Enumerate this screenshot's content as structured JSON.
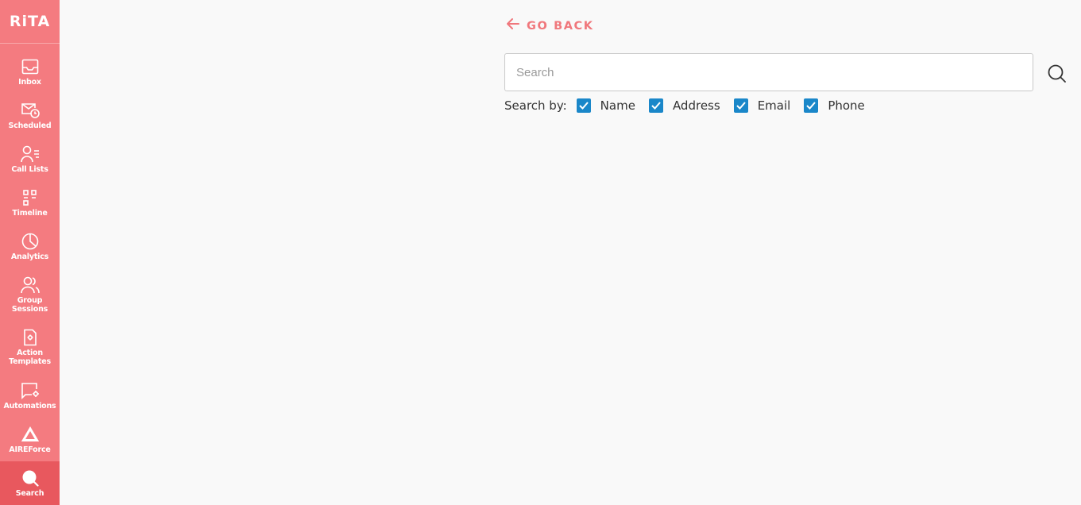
{
  "app": {
    "logo_text": "RiTA"
  },
  "colors": {
    "sidebar": "#f47b80",
    "sidebar_active": "#e8585e",
    "accent": "#f0777c",
    "checkbox": "#1a87c9"
  },
  "sidebar": {
    "items": [
      {
        "label": "Inbox",
        "icon": "inbox-icon"
      },
      {
        "label": "Scheduled",
        "icon": "scheduled-icon"
      },
      {
        "label": "Call Lists",
        "icon": "call-lists-icon"
      },
      {
        "label": "Timeline",
        "icon": "timeline-icon"
      },
      {
        "label": "Analytics",
        "icon": "analytics-icon"
      },
      {
        "label": "Group Sessions",
        "icon": "group-sessions-icon"
      },
      {
        "label": "Action Templates",
        "icon": "action-templates-icon"
      },
      {
        "label": "Automations",
        "icon": "automations-icon"
      },
      {
        "label": "AIREForce",
        "icon": "aireforce-icon"
      },
      {
        "label": "Search",
        "icon": "search-icon",
        "active": true
      }
    ]
  },
  "main": {
    "go_back_label": "GO BACK",
    "search": {
      "placeholder": "Search",
      "value": ""
    },
    "search_by": {
      "title": "Search by:",
      "options": [
        {
          "label": "Name",
          "checked": true
        },
        {
          "label": "Address",
          "checked": true
        },
        {
          "label": "Email",
          "checked": true
        },
        {
          "label": "Phone",
          "checked": true
        }
      ]
    }
  }
}
